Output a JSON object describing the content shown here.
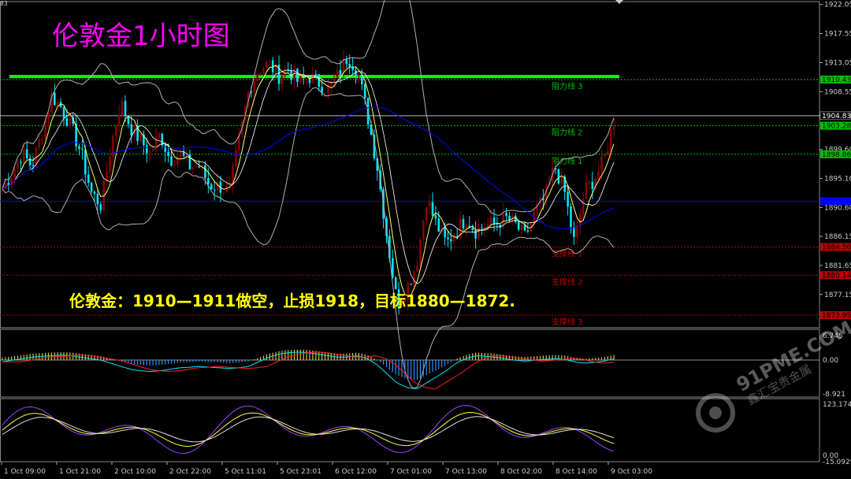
{
  "corner_label": "83",
  "title": "伦敦金1小时图",
  "note": "伦敦金：1910—1911做空，止损1918，目标1880—1872.",
  "watermark": {
    "brand": "91PME.COM",
    "sub": "鑫汇宝贵金属"
  },
  "colors": {
    "background": "#000000",
    "up_candle": "#8b0000",
    "down_candle": "#00e5ff",
    "ma_fast": "#ffff66",
    "ma_slow": "#0000ff",
    "bollinger": "#b0b0b0",
    "key_line": "#00ff00",
    "resistance": "#00c000",
    "support": "#c00000"
  },
  "chart_data": [
    {
      "type": "candlestick",
      "price_axis": {
        "min": 1872.0,
        "max": 1922.5,
        "ticks": [
          1922.05,
          1917.55,
          1913.05,
          1908.55,
          1904.83,
          1899.6,
          1895.1,
          1890.6,
          1886.15,
          1881.65,
          1877.15
        ]
      },
      "x_ticks": [
        "1 Oct 09:00",
        "1 Oct 21:00",
        "2 Oct 10:00",
        "2 Oct 22:00",
        "5 Oct 11:01",
        "5 Oct 23:01",
        "6 Oct 12:00",
        "7 Oct 01:00",
        "7 Oct 13:00",
        "8 Oct 02:00",
        "8 Oct 14:00",
        "9 Oct 03:00"
      ],
      "horizontal_levels": [
        {
          "label": "阻力线 3",
          "price": 1910.43,
          "tag": "1910.43",
          "kind": "resistance"
        },
        {
          "label": "阻力线 2",
          "price": 1903.28,
          "tag": "1903.28",
          "kind": "resistance"
        },
        {
          "label": "阻力线 1",
          "price": 1898.86,
          "tag": "1898.86",
          "kind": "resistance"
        },
        {
          "label": "支撑线 1",
          "price": 1884.5,
          "tag": "1884.50",
          "kind": "support"
        },
        {
          "label": "支撑线 2",
          "price": 1880.14,
          "tag": "1880.14",
          "kind": "support"
        },
        {
          "label": "支撑线 3",
          "price": 1873.95,
          "tag": "1873.95",
          "kind": "support"
        }
      ],
      "key_level": 1910.9,
      "current_price": 1904.83,
      "ma_slow_tag_price": 1891.6,
      "close_path": [
        1893.5,
        1896,
        1899,
        1897,
        1902,
        1908,
        1906,
        1903,
        1899,
        1893,
        1891,
        1900,
        1907,
        1903,
        1901,
        1899,
        1902,
        1898,
        1899,
        1897,
        1897,
        1894,
        1894,
        1893,
        1901,
        1909,
        1912,
        1913,
        1911,
        1912,
        1910,
        1911,
        1910,
        1909,
        1911,
        1914,
        1912,
        1905,
        1897,
        1886,
        1876,
        1878,
        1882,
        1892,
        1888,
        1885,
        1887,
        1889,
        1887,
        1888,
        1888,
        1889,
        1888,
        1886,
        1890,
        1892,
        1897,
        1893,
        1885,
        1893,
        1895,
        1898,
        1904
      ]
    },
    {
      "type": "macd",
      "axis_ticks": [
        "6.745",
        "0.00",
        "-8.921"
      ],
      "histogram": [
        1,
        1.5,
        2,
        2.5,
        2.8,
        3,
        3.2,
        3,
        2.5,
        2,
        1.5,
        0.5,
        -0.5,
        -1.5,
        -2,
        -2.2,
        -2,
        -1.5,
        -1,
        -0.8,
        -0.5,
        -0.8,
        -1,
        -1.2,
        -1,
        -0.5,
        1,
        2.5,
        3.5,
        4,
        4.2,
        4,
        3.5,
        3,
        2.5,
        2.6,
        3,
        2,
        0,
        -3,
        -6,
        -7.5,
        -8,
        -6,
        -4,
        -2,
        0.5,
        2,
        3,
        2.8,
        2.5,
        2,
        1.5,
        1.2,
        1.5,
        1.8,
        2,
        1.8,
        1,
        0.5,
        0.8,
        1.2,
        2
      ]
    },
    {
      "type": "oscillator",
      "axis_ticks": [
        "123.1747",
        "0.00",
        "-15.0929"
      ]
    }
  ]
}
